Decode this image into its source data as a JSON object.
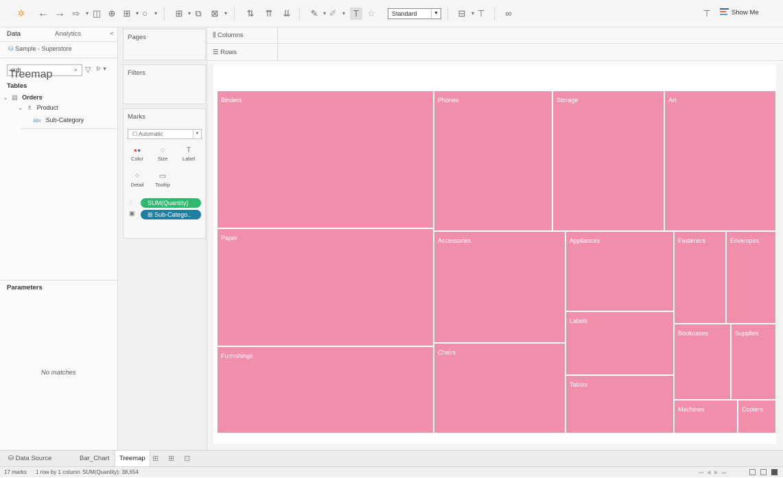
{
  "toolbar": {
    "icons": [
      "tableau-logo-icon",
      "undo-icon",
      "redo-icon",
      "save-icon",
      "new-datasource-icon",
      "pause-icon",
      "refresh-icon",
      "new-sheet-icon",
      "duplicate-icon",
      "clear-icon",
      "swap-icon",
      "sort-asc-icon",
      "sort-desc-icon",
      "highlight-icon",
      "group-icon",
      "labels-icon",
      "pin-icon",
      "fit-icon",
      "presentation-icon",
      "share-icon"
    ],
    "fit_select": "Standard",
    "show_me": "Show Me"
  },
  "data_pane": {
    "tab_data": "Data",
    "tab_analytics": "Analytics",
    "collapse": "<",
    "datasource": "Sample - Superstore",
    "search_value": "sub",
    "tables_heading": "Tables",
    "tree": {
      "table": "Orders",
      "folder": "Product",
      "field_type": "Abc",
      "field": "Sub-Category"
    },
    "parameters_heading": "Parameters",
    "no_matches": "No matches"
  },
  "shelves": {
    "pages": "Pages",
    "filters": "Filters",
    "marks": "Marks",
    "mark_type": "Automatic",
    "mark_buttons": [
      "Color",
      "Size",
      "Label",
      "Detail",
      "Tooltip"
    ],
    "pills": [
      {
        "label": "SUM(Quantity)",
        "color": "#2dba6e"
      },
      {
        "label": "⊞ Sub-Catego..",
        "color": "#1e7fa0"
      }
    ],
    "columns": "Columns",
    "rows": "Rows"
  },
  "worksheet": {
    "title": "Treemap"
  },
  "chart_data": {
    "type": "treemap",
    "title": "Treemap",
    "color": "#f18fab",
    "categories": [
      "Binders",
      "Paper",
      "Furnishings",
      "Phones",
      "Storage",
      "Art",
      "Accessories",
      "Chairs",
      "Appliances",
      "Labels",
      "Tables",
      "Fasteners",
      "Envelopes",
      "Bookcases",
      "Supplies",
      "Machines",
      "Copiers"
    ]
  },
  "tabs": {
    "data_source": "Data Source",
    "sheets": [
      "Bar_Chart",
      "Treemap"
    ],
    "active": "Treemap"
  },
  "status": {
    "marks": "17 marks",
    "rows_cols": "1 row by 1 column",
    "sum": "SUM(Quantity): 38,654"
  }
}
